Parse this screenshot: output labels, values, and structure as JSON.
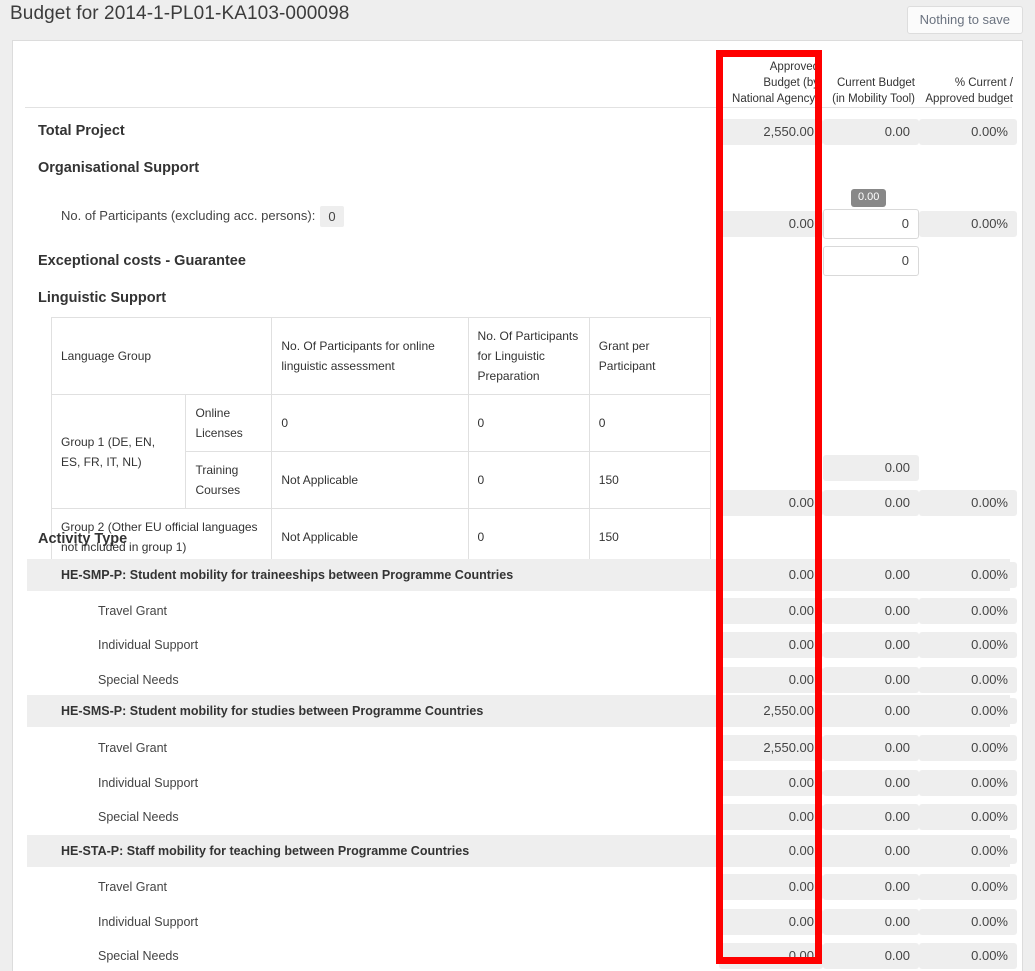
{
  "header": {
    "title": "Budget for 2014-1-PL01-KA103-000098",
    "save_label": "Nothing to save"
  },
  "columns": {
    "approved": "Approved Budget (by National Agency)",
    "approved_l1": "Approved",
    "approved_l2": "Budget (by",
    "approved_l3": "National Agency)",
    "current": "Current Budget (in Mobility Tool)",
    "current_l1": "Current Budget",
    "current_l2": "(in Mobility Tool)",
    "percent": "% Current / Approved budget",
    "percent_l1": "% Current /",
    "percent_l2": "Approved budget"
  },
  "highlight": {
    "color": "#ff0000",
    "target_column": "Approved Budget (by National Agency)"
  },
  "total_project": {
    "label": "Total Project",
    "approved": "2,550.00",
    "current": "0.00",
    "percent": "0.00%"
  },
  "organisational_support": {
    "label": "Organisational Support",
    "participants_label": "No. of Participants (excluding acc. persons):",
    "participants_value": "0",
    "tooltip": "0.00",
    "approved": "0.00",
    "current_input": "0",
    "percent": "0.00%"
  },
  "exceptional_costs": {
    "label": "Exceptional costs - Guarantee",
    "current_input": "0"
  },
  "linguistic_support": {
    "label": "Linguistic Support",
    "headers": {
      "language_group": "Language Group",
      "online_assessment": "No. Of Participants for online linguistic assessment",
      "linguistic_preparation": "No. Of Participants for Linguistic Preparation",
      "grant_per_participant": "Grant per Participant"
    },
    "rows": [
      {
        "group": "Group 1 (DE, EN, ES, FR, IT, NL)",
        "sub": "Online Licenses",
        "online_assessment": "0",
        "linguistic_preparation": "0",
        "grant": "0"
      },
      {
        "group": "",
        "sub": "Training Courses",
        "online_assessment": "Not Applicable",
        "linguistic_preparation": "0",
        "grant": "150"
      },
      {
        "group": "Group 2 (Other EU official languages not included in group 1)",
        "sub": "",
        "online_assessment": "Not Applicable",
        "linguistic_preparation": "0",
        "grant": "150"
      }
    ],
    "current_extra": "0.00",
    "totals": {
      "approved": "0.00",
      "current": "0.00",
      "percent": "0.00%"
    }
  },
  "activity_type": {
    "label": "Activity Type",
    "groups": [
      {
        "title": "HE-SMP-P: Student mobility for traineeships between Programme Countries",
        "approved": "0.00",
        "current": "0.00",
        "percent": "0.00%",
        "items": [
          {
            "label": "Travel Grant",
            "approved": "0.00",
            "current": "0.00",
            "percent": "0.00%"
          },
          {
            "label": "Individual Support",
            "approved": "0.00",
            "current": "0.00",
            "percent": "0.00%"
          },
          {
            "label": "Special Needs",
            "approved": "0.00",
            "current": "0.00",
            "percent": "0.00%"
          }
        ]
      },
      {
        "title": "HE-SMS-P: Student mobility for studies between Programme Countries",
        "approved": "2,550.00",
        "current": "0.00",
        "percent": "0.00%",
        "items": [
          {
            "label": "Travel Grant",
            "approved": "2,550.00",
            "current": "0.00",
            "percent": "0.00%"
          },
          {
            "label": "Individual Support",
            "approved": "0.00",
            "current": "0.00",
            "percent": "0.00%"
          },
          {
            "label": "Special Needs",
            "approved": "0.00",
            "current": "0.00",
            "percent": "0.00%"
          }
        ]
      },
      {
        "title": "HE-STA-P: Staff mobility for teaching between Programme Countries",
        "approved": "0.00",
        "current": "0.00",
        "percent": "0.00%",
        "items": [
          {
            "label": "Travel Grant",
            "approved": "0.00",
            "current": "0.00",
            "percent": "0.00%"
          },
          {
            "label": "Individual Support",
            "approved": "0.00",
            "current": "0.00",
            "percent": "0.00%"
          },
          {
            "label": "Special Needs",
            "approved": "0.00",
            "current": "0.00",
            "percent": "0.00%"
          }
        ]
      }
    ]
  }
}
